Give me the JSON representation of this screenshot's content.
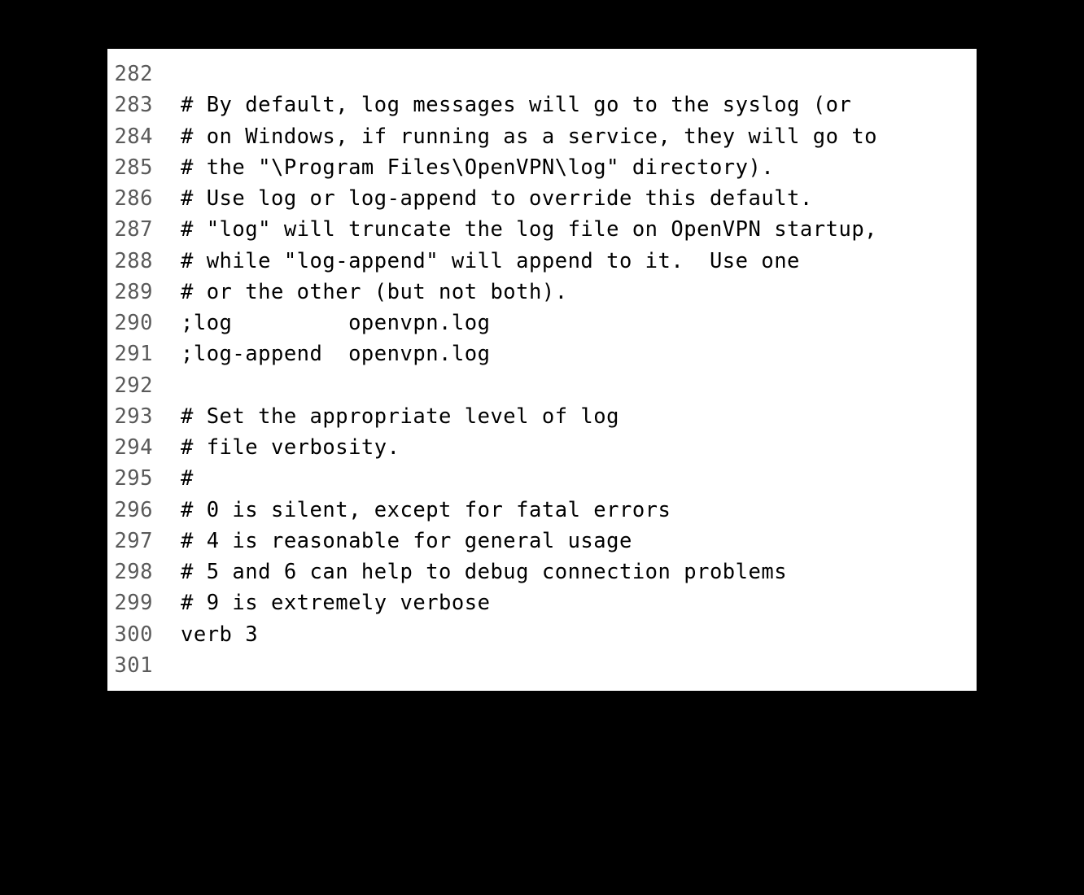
{
  "code": {
    "lines": [
      {
        "number": "282",
        "content": ""
      },
      {
        "number": "283",
        "content": "# By default, log messages will go to the syslog (or"
      },
      {
        "number": "284",
        "content": "# on Windows, if running as a service, they will go to"
      },
      {
        "number": "285",
        "content": "# the \"\\Program Files\\OpenVPN\\log\" directory)."
      },
      {
        "number": "286",
        "content": "# Use log or log-append to override this default."
      },
      {
        "number": "287",
        "content": "# \"log\" will truncate the log file on OpenVPN startup,"
      },
      {
        "number": "288",
        "content": "# while \"log-append\" will append to it.  Use one"
      },
      {
        "number": "289",
        "content": "# or the other (but not both)."
      },
      {
        "number": "290",
        "content": ";log         openvpn.log"
      },
      {
        "number": "291",
        "content": ";log-append  openvpn.log"
      },
      {
        "number": "292",
        "content": ""
      },
      {
        "number": "293",
        "content": "# Set the appropriate level of log"
      },
      {
        "number": "294",
        "content": "# file verbosity."
      },
      {
        "number": "295",
        "content": "#"
      },
      {
        "number": "296",
        "content": "# 0 is silent, except for fatal errors"
      },
      {
        "number": "297",
        "content": "# 4 is reasonable for general usage"
      },
      {
        "number": "298",
        "content": "# 5 and 6 can help to debug connection problems"
      },
      {
        "number": "299",
        "content": "# 9 is extremely verbose"
      },
      {
        "number": "300",
        "content": "verb 3"
      },
      {
        "number": "301",
        "content": ""
      }
    ]
  }
}
